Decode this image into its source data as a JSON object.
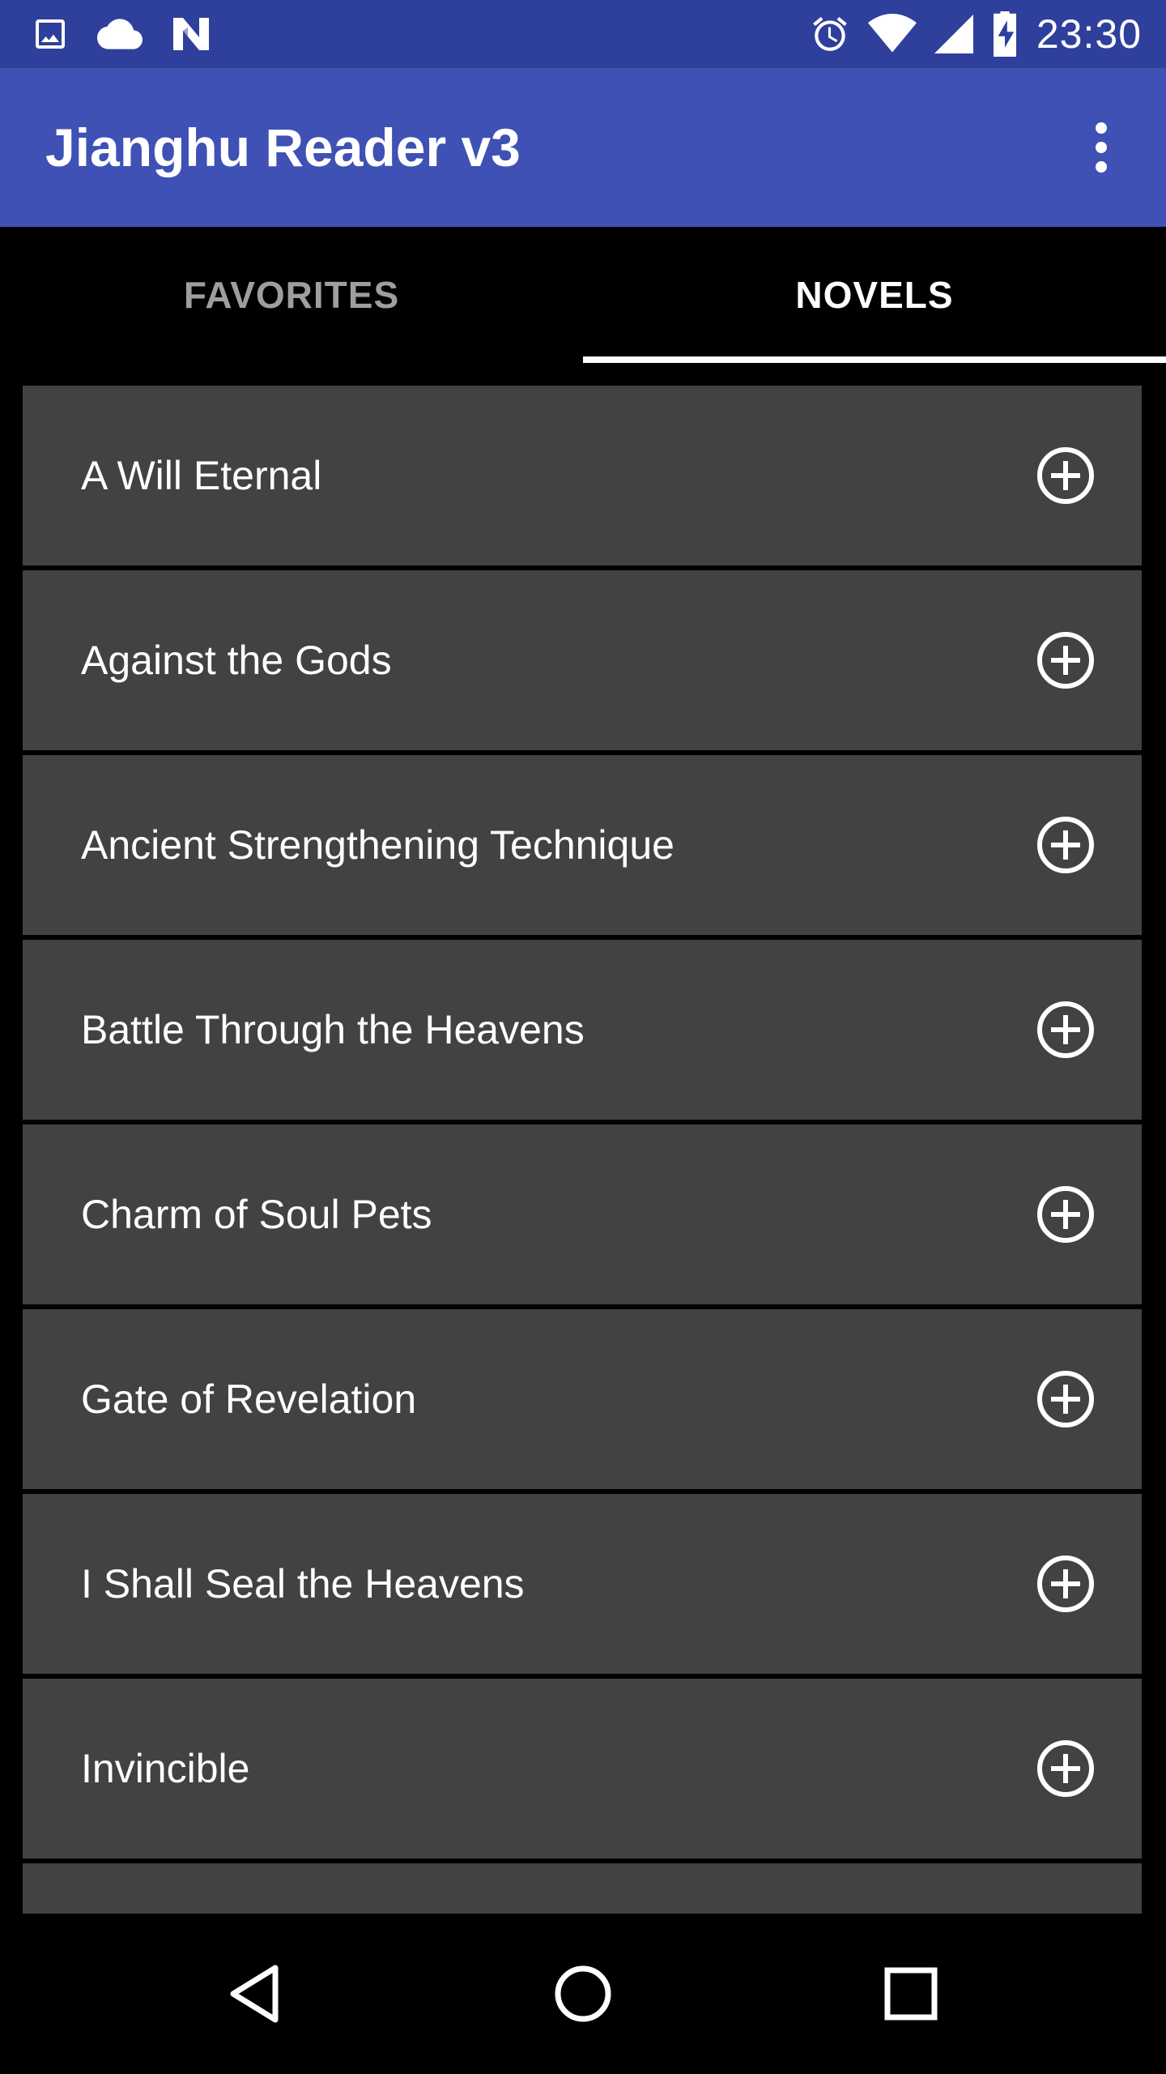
{
  "status_bar": {
    "time": "23:30",
    "icons": [
      "image-icon",
      "cloud-icon",
      "n-notification-icon",
      "alarm-icon",
      "wifi-icon",
      "cellular-signal-icon",
      "battery-charging-icon"
    ]
  },
  "app_bar": {
    "title": "Jianghu Reader v3",
    "overflow_icon": "more-vert-icon"
  },
  "tabs": [
    {
      "label": "FAVORITES",
      "active": false
    },
    {
      "label": "NOVELS",
      "active": true
    }
  ],
  "novels": [
    {
      "title": "A Will Eternal",
      "action_icon": "add-circle-icon"
    },
    {
      "title": "Against the Gods",
      "action_icon": "add-circle-icon"
    },
    {
      "title": "Ancient Strengthening Technique",
      "action_icon": "add-circle-icon"
    },
    {
      "title": "Battle Through the Heavens",
      "action_icon": "add-circle-icon"
    },
    {
      "title": "Charm of Soul Pets",
      "action_icon": "add-circle-icon"
    },
    {
      "title": "Gate of Revelation",
      "action_icon": "add-circle-icon"
    },
    {
      "title": "I Shall Seal the Heavens",
      "action_icon": "add-circle-icon"
    },
    {
      "title": "Invincible",
      "action_icon": "add-circle-icon"
    }
  ],
  "nav_bar": {
    "icons": [
      "back-icon",
      "home-icon",
      "recents-icon"
    ]
  },
  "colors": {
    "status_bar": "#2f3f9c",
    "app_bar": "#3f51b5",
    "list_item": "#424242",
    "background": "#000000",
    "inactive_tab": "#9e9e9e"
  }
}
